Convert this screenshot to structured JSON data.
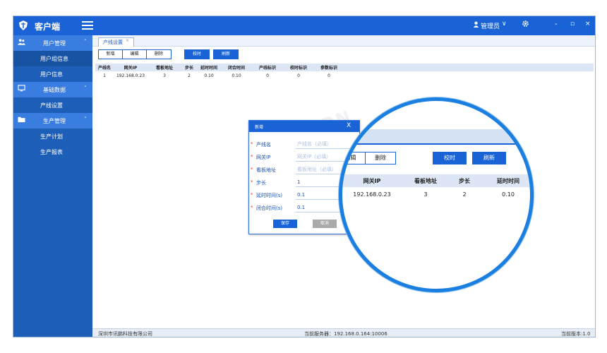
{
  "header": {
    "app_title": "客户端",
    "logo_icon": "shield-logo-icon",
    "user_name": "管理员",
    "user_chevron": "∨",
    "window_min": "-",
    "window_restore": "▫",
    "window_close": "×"
  },
  "sidebar": {
    "sections": [
      {
        "label": "用户管理",
        "icon": "users-icon",
        "items": [
          "用户组信息",
          "用户信息"
        ]
      },
      {
        "label": "基础数据",
        "icon": "monitor-icon",
        "items": [
          "产线设置"
        ]
      },
      {
        "label": "生产管理",
        "icon": "folder-icon",
        "items": [
          "生产计划",
          "生产报表"
        ]
      }
    ]
  },
  "tabs": {
    "active": "产线设置"
  },
  "toolbar": {
    "add": "新增",
    "edit": "编辑",
    "delete": "删除",
    "calibrate": "校时",
    "refresh": "刷新"
  },
  "table": {
    "headers": [
      "产线名",
      "网关IP",
      "看板地址",
      "步长",
      "延时时间",
      "闭合时间",
      "产线标识",
      "校时标识",
      "参数标识"
    ],
    "rows": [
      [
        "1",
        "192.168.0.23",
        "3",
        "2",
        "0.10",
        "0.10",
        "0",
        "0",
        "0"
      ]
    ]
  },
  "dialog": {
    "title": "新增",
    "close": "X",
    "fields": [
      {
        "label": "产线名",
        "value": "",
        "placeholder": "产线名（必填）"
      },
      {
        "label": "网关IP",
        "value": "",
        "placeholder": "网关IP（必填）"
      },
      {
        "label": "看板地址",
        "value": "",
        "placeholder": "看板地址（必填）"
      },
      {
        "label": "步长",
        "value": "1",
        "placeholder": ""
      },
      {
        "label": "延时时间(s)",
        "value": "0.1",
        "placeholder": ""
      },
      {
        "label": "闭合时间(s)",
        "value": "0.1",
        "placeholder": ""
      }
    ],
    "save": "保存",
    "cancel": "取消"
  },
  "magnifier": {
    "edit": "编辑",
    "delete": "删除",
    "calibrate": "校时",
    "refresh": "刷新",
    "headers": [
      "网关IP",
      "看板地址",
      "步长",
      "延时时间"
    ],
    "row": [
      "192.168.0.23",
      "3",
      "2",
      "0.10"
    ]
  },
  "footer": {
    "company": "深圳市讯鹏科技有限公司",
    "server": "当前服务器：192.168.0.164:10006",
    "version": "当前版本:1.0"
  },
  "colors": {
    "primary": "#1a63d6",
    "sidebar": "#1d5fb8",
    "sidebar_section": "#3a7de0",
    "magnifier_ring": "#1a7fe0"
  }
}
